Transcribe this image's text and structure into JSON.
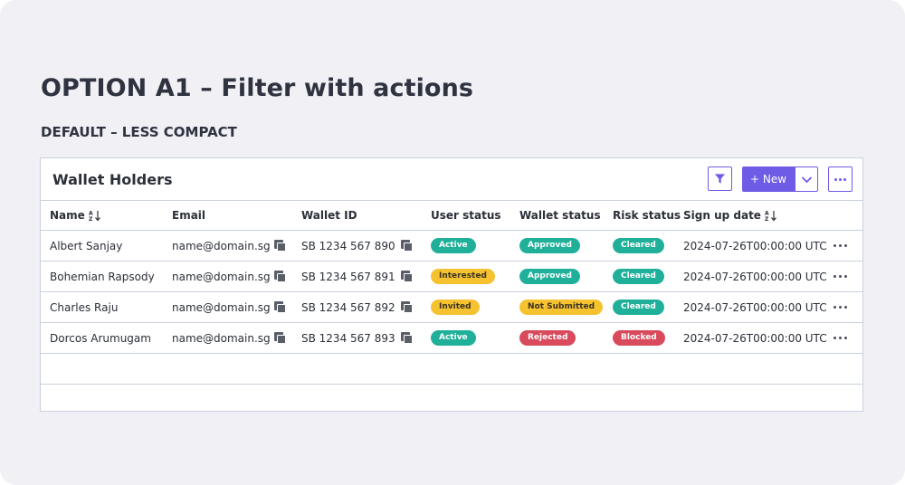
{
  "page": {
    "title": "OPTION A1 – Filter with actions",
    "subtitle": "DEFAULT – LESS COMPACT"
  },
  "panel": {
    "title": "Wallet Holders",
    "filter_icon": "filter-icon",
    "new_button_label": "+ New",
    "new_caret_icon": "chevron-down-icon",
    "more_icon": "more-horizontal-icon"
  },
  "colors": {
    "accent": "#6e5ce6",
    "teal": "#20b09a",
    "yellow": "#f6c230",
    "red": "#d84a5c"
  },
  "table": {
    "columns": {
      "name": "Name",
      "email": "Email",
      "wallet_id": "Wallet ID",
      "user_status": "User status",
      "wallet_status": "Wallet status",
      "risk_status": "Risk status",
      "sign_up_date": "Sign up date"
    },
    "sort_icon": "sort-az-icon",
    "copy_icon": "copy-icon",
    "row_action_icon": "more-horizontal-icon",
    "rows": [
      {
        "name": "Albert Sanjay",
        "email": "name@domain.sg",
        "wallet_id": "SB 1234 567 890",
        "user_status": {
          "label": "Active",
          "color": "teal"
        },
        "wallet_status": {
          "label": "Approved",
          "color": "teal"
        },
        "risk_status": {
          "label": "Cleared",
          "color": "teal"
        },
        "sign_up_date": "2024-07-26T00:00:00 UTC"
      },
      {
        "name": "Bohemian Rapsody",
        "email": "name@domain.sg",
        "wallet_id": "SB 1234 567 891",
        "user_status": {
          "label": "Interested",
          "color": "yellow"
        },
        "wallet_status": {
          "label": "Approved",
          "color": "teal"
        },
        "risk_status": {
          "label": "Cleared",
          "color": "teal"
        },
        "sign_up_date": "2024-07-26T00:00:00 UTC"
      },
      {
        "name": "Charles Raju",
        "email": "name@domain.sg",
        "wallet_id": "SB 1234 567 892",
        "user_status": {
          "label": "Invited",
          "color": "yellow"
        },
        "wallet_status": {
          "label": "Not Submitted",
          "color": "yellow"
        },
        "risk_status": {
          "label": "Cleared",
          "color": "teal"
        },
        "sign_up_date": "2024-07-26T00:00:00 UTC"
      },
      {
        "name": "Dorcos Arumugam",
        "email": "name@domain.sg",
        "wallet_id": "SB 1234 567 893",
        "user_status": {
          "label": "Active",
          "color": "teal"
        },
        "wallet_status": {
          "label": "Rejected",
          "color": "red"
        },
        "risk_status": {
          "label": "Blocked",
          "color": "red"
        },
        "sign_up_date": "2024-07-26T00:00:00 UTC"
      }
    ],
    "empty_rows": 2
  }
}
